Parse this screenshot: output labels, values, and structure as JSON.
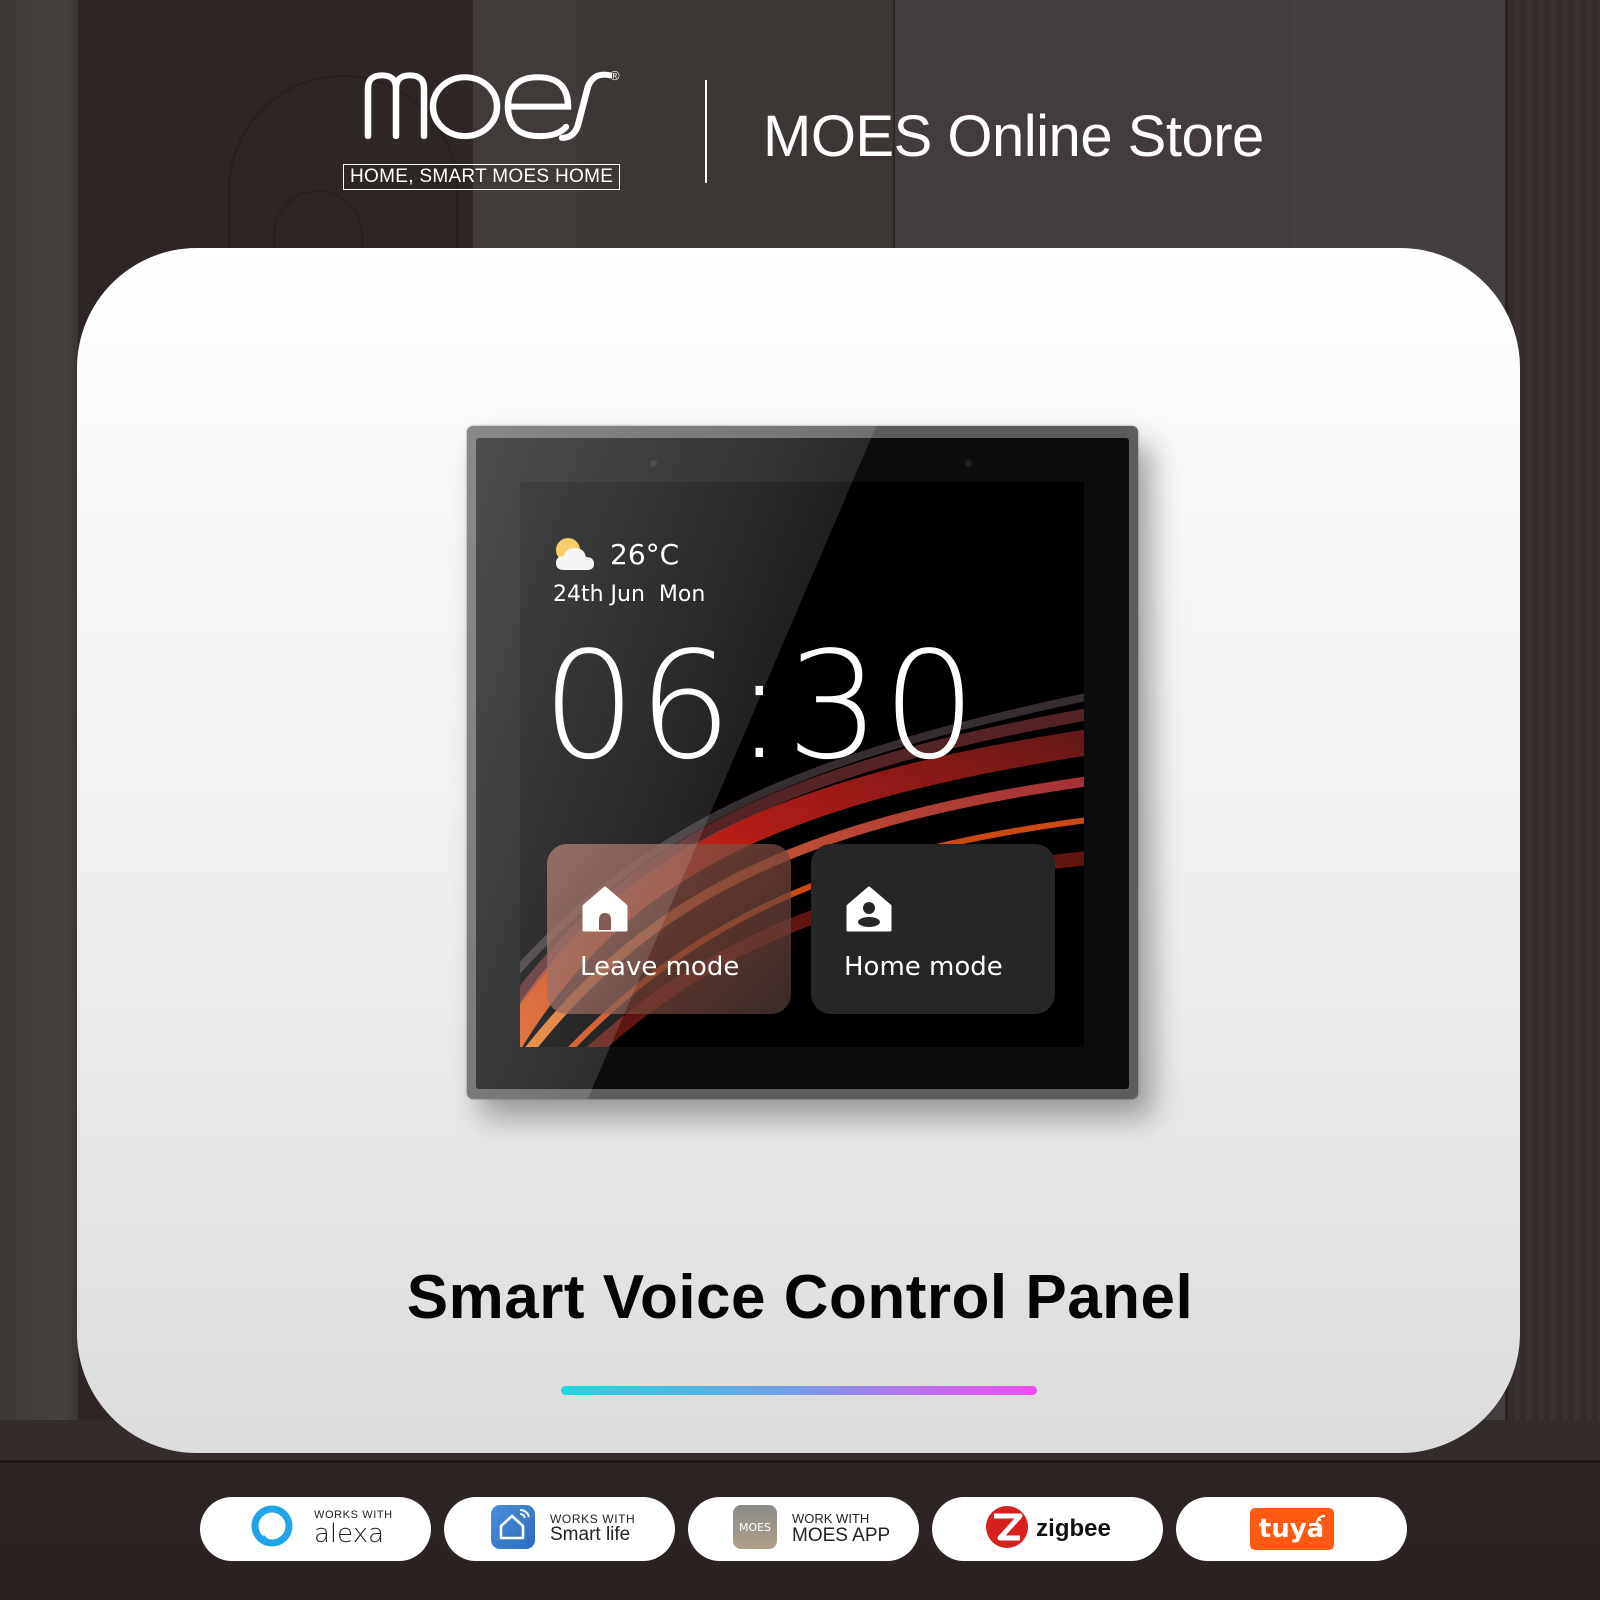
{
  "header": {
    "logo_wordmark": "MOES",
    "logo_registered": "®",
    "logo_tagline": "HOME, SMART MOES HOME",
    "store_title": "MOES Online Store"
  },
  "device_screen": {
    "weather_icon": "partly-cloudy-icon",
    "temperature": "26°C",
    "date": "24th Jun  Mon",
    "time": "06:30",
    "modes": [
      {
        "label": "Leave mode",
        "icon": "house-leave-icon"
      },
      {
        "label": "Home mode",
        "icon": "house-person-icon"
      }
    ]
  },
  "product": {
    "title": "Smart Voice Control Panel",
    "accent_gradient": [
      "#1fd8dc",
      "#7b9be6",
      "#f24cf0"
    ]
  },
  "badges": [
    {
      "name": "alexa",
      "small": "WORKS WITH",
      "big": "alexa",
      "color": "#1fa4e8"
    },
    {
      "name": "smart-life",
      "small": "WORKS WITH",
      "big": "Smart life",
      "color": "#3a7fd0"
    },
    {
      "name": "moes-app",
      "small": "WORK WITH",
      "big": "MOES APP",
      "icon_text": "MOES",
      "color": "#9a9288"
    },
    {
      "name": "zigbee",
      "big": "zigbee",
      "color": "#d6201c"
    },
    {
      "name": "tuya",
      "big": "tuya",
      "color": "#ff5a11"
    }
  ]
}
